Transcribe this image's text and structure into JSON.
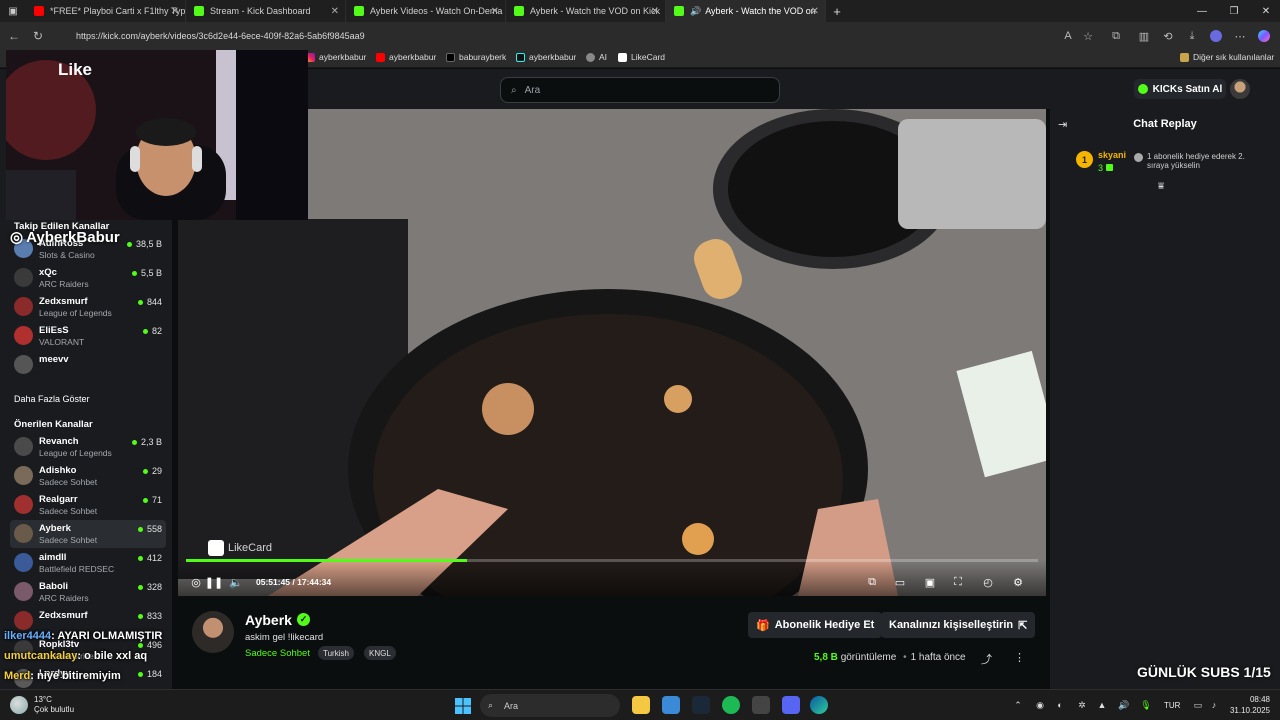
{
  "browser": {
    "tabs": [
      {
        "title": "*FREE* Playboi Carti x F1lthy Type",
        "fav_color": "#ff0000"
      },
      {
        "title": "Stream - Kick Dashboard",
        "fav_color": "#53fc18"
      },
      {
        "title": "Ayberk Videos - Watch On-Dema",
        "fav_color": "#53fc18"
      },
      {
        "title": "Ayberk - Watch the VOD on Kick",
        "fav_color": "#53fc18"
      },
      {
        "title": "Ayberk - Watch the VOD on",
        "fav_color": "#53fc18"
      }
    ],
    "new_tab": "+",
    "url": "https://kick.com/ayberk/videos/3c6d2e44-6ece-409f-82a6-5ab6f9845aa9",
    "bookmarks": [
      "ayberkbabur",
      "ayberkbabur",
      "baburayberk",
      "ayberkbabur",
      "AI",
      "LikeCard"
    ],
    "other_bookmarks": "Diğer sık kullanılanlar"
  },
  "overlay_logo": "Like",
  "kick": {
    "search_placeholder": "Ara",
    "kicks_button": "KICKs Satın Al",
    "sidebar": {
      "followed_title": "Takip Edilen Kanallar",
      "followed": [
        {
          "name": "AdinRoss",
          "category": "Slots & Casino",
          "viewers": "38,5 B",
          "color": "#5a7db0"
        },
        {
          "name": "xQc",
          "category": "ARC Raiders",
          "viewers": "5,5 B",
          "color": "#3a3a3a"
        },
        {
          "name": "Zedxsmurf",
          "category": "League of Legends",
          "viewers": "844",
          "color": "#8a2a2a"
        },
        {
          "name": "EliEsS",
          "category": "VALORANT",
          "viewers": "82",
          "color": "#b03030"
        },
        {
          "name": "meevv",
          "category": "",
          "viewers": "",
          "color": "#555555"
        }
      ],
      "show_more": "Daha Fazla Göster",
      "suggested_title": "Önerilen Kanallar",
      "suggested": [
        {
          "name": "Revanch",
          "category": "League of Legends",
          "viewers": "2,3 B",
          "color": "#4a4a4a"
        },
        {
          "name": "Adishko",
          "category": "Sadece Sohbet",
          "viewers": "29",
          "color": "#7a6a5a"
        },
        {
          "name": "Realgarr",
          "category": "Sadece Sohbet",
          "viewers": "71",
          "color": "#a03030"
        },
        {
          "name": "Ayberk",
          "category": "Sadece Sohbet",
          "viewers": "558",
          "color": "#6a5a4a"
        },
        {
          "name": "aimdll",
          "category": "Battlefield REDSEC",
          "viewers": "412",
          "color": "#3a5a9a"
        },
        {
          "name": "Baboli",
          "category": "ARC Raiders",
          "viewers": "328",
          "color": "#7a5a6a"
        },
        {
          "name": "Zedxsmurf",
          "category": "",
          "viewers": "833",
          "color": "#8a2a2a"
        },
        {
          "name": "Ropkl3tv",
          "category": "Counter-Strike 2",
          "viewers": "496",
          "color": "#3a3a3a"
        },
        {
          "name": "Lordyy",
          "category": "",
          "viewers": "184",
          "color": "#5a5a5a"
        }
      ]
    },
    "video": {
      "watermark": "LikeCard",
      "timecode": "05:51:45 / 17:44:34",
      "progress": 0.33
    },
    "chat": {
      "title": "Chat Replay",
      "entry": {
        "badge": "1",
        "user": "skyani",
        "count": "3",
        "message": "1 abonelik hediye ederek 2. sıraya yükselin"
      }
    },
    "channel": {
      "name": "Ayberk",
      "verified": "✓",
      "stream_title": "askim gel !likecard",
      "category": "Sadece Sohbet",
      "tags": [
        "Turkish",
        "KNGL"
      ],
      "gift_button": "Abonelik Hediye Et",
      "customize_button": "Kanalınızı kişiselleştirin",
      "views_value": "5,8 B",
      "views_label": "görüntüleme",
      "age": "1 hafta önce"
    }
  },
  "stream_overlay": {
    "instagram": "AyberkBabur",
    "chat_lines": [
      {
        "user": "ilker4444",
        "text": ": AYARI OLMAMIŞTIR"
      },
      {
        "user": "umutcankalay",
        "text": ": o bile xxl aq"
      },
      {
        "user": "Merd",
        "text": ": niye bitiremiyim"
      }
    ],
    "subs_goal": "GÜNLÜK SUBS 1/15"
  },
  "taskbar": {
    "temperature": "13°C",
    "weather": "Çok bulutlu",
    "search": "Ara",
    "lang": "TUR",
    "time": "08:48",
    "date": "31.10.2025"
  },
  "colors": {
    "kick_green": "#53fc18",
    "panel": "#191b1f",
    "background": "#0b0e0f"
  }
}
